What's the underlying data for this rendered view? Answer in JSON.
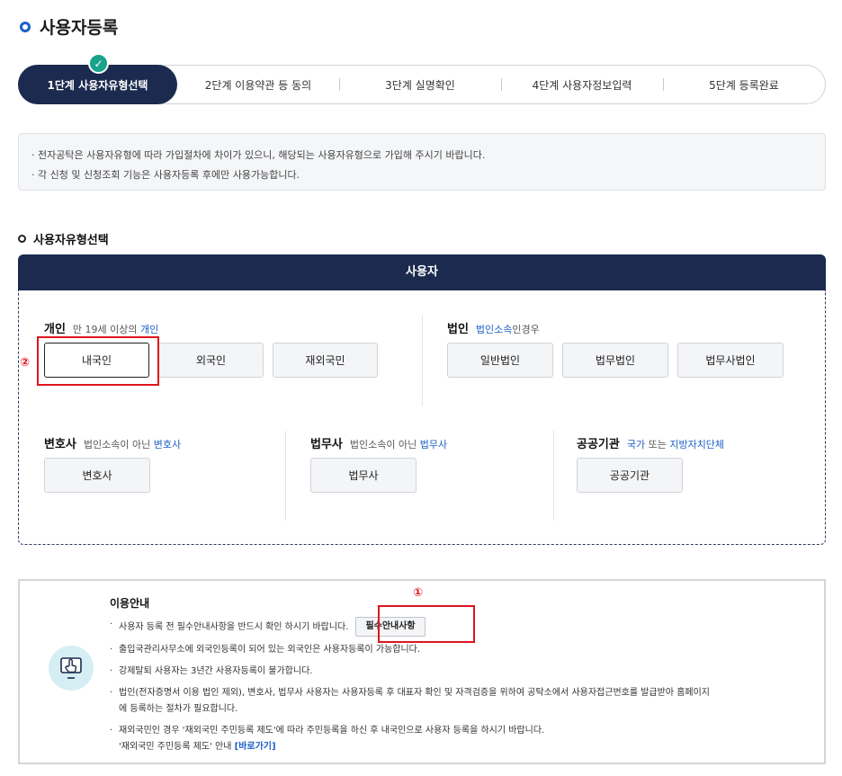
{
  "page": {
    "title": "사용자등록"
  },
  "steps": [
    {
      "label": "1단계 사용자유형선택",
      "active": true
    },
    {
      "label": "2단계 이용약관 등 동의"
    },
    {
      "label": "3단계 실명확인"
    },
    {
      "label": "4단계 사용자정보입력"
    },
    {
      "label": "5단계 등록완료"
    }
  ],
  "step_check_icon": "check-icon",
  "notice": {
    "line1": "· 전자공탁은 사용자유형에 따라 가입절차에 차이가 있으니, 해당되는 사용자유형으로 가입해 주시기 바랍니다.",
    "line2": "· 각 신청 및 신청조회 기능은 사용자등록 후에만 사용가능합니다."
  },
  "section_title": "사용자유형선택",
  "user_header": "사용자",
  "groups": {
    "individual": {
      "title": "개인",
      "desc_prefix": "만 19세 이상의 ",
      "desc_hl": "개인",
      "buttons": [
        "내국인",
        "외국인",
        "재외국민"
      ]
    },
    "corporate": {
      "title": "법인",
      "desc_hl": "법인소속",
      "desc_suffix": "인경우",
      "buttons": [
        "일반법인",
        "법무법인",
        "법무사법인"
      ]
    },
    "lawyer": {
      "title": "변호사",
      "desc_prefix": "법인소속이 아닌 ",
      "desc_hl": "변호사",
      "buttons": [
        "변호사"
      ]
    },
    "scrivener": {
      "title": "법무사",
      "desc_prefix": "법인소속이 아닌 ",
      "desc_hl": "법무사",
      "buttons": [
        "법무사"
      ]
    },
    "public": {
      "title": "공공기관",
      "desc_hl": "국가",
      "desc_mid": " 또는 ",
      "desc_hl2": "지방자치단체",
      "buttons": [
        "공공기관"
      ]
    }
  },
  "markers": {
    "m1": "①",
    "m2": "②"
  },
  "guide": {
    "title": "이용안내",
    "item1": "사용자 등록 전 필수안내사항을 반드시 확인 하시기 바랍니다.",
    "item1_button": "필수안내사항",
    "item2": "출입국관리사무소에 외국인등록이 되어 있는 외국인은 사용자등록이 가능합니다.",
    "item3": "강제탈퇴 사용자는 3년간 사용자등록이 불가합니다.",
    "item4": "법인(전자증명서 이용 법인 제외), 변호사, 법무사 사용자는 사용자등록 후 대표자 확인 및 자격검증을 위하여 공탁소에서 사용자접근번호를 발급받아 홈페이지",
    "item4_cont": "에 등록하는 절차가 필요합니다.",
    "item5": "재외국민인 경우 '재외국민 주민등록 제도'에 따라 주민등록을 하신 후 내국인으로 사용자 등록을 하시기 바랍니다.",
    "item5_cont": "'재외국민 주민등록 제도' 안내 ",
    "item5_link": "[바로가기]",
    "icon": "touch-screen-icon"
  }
}
